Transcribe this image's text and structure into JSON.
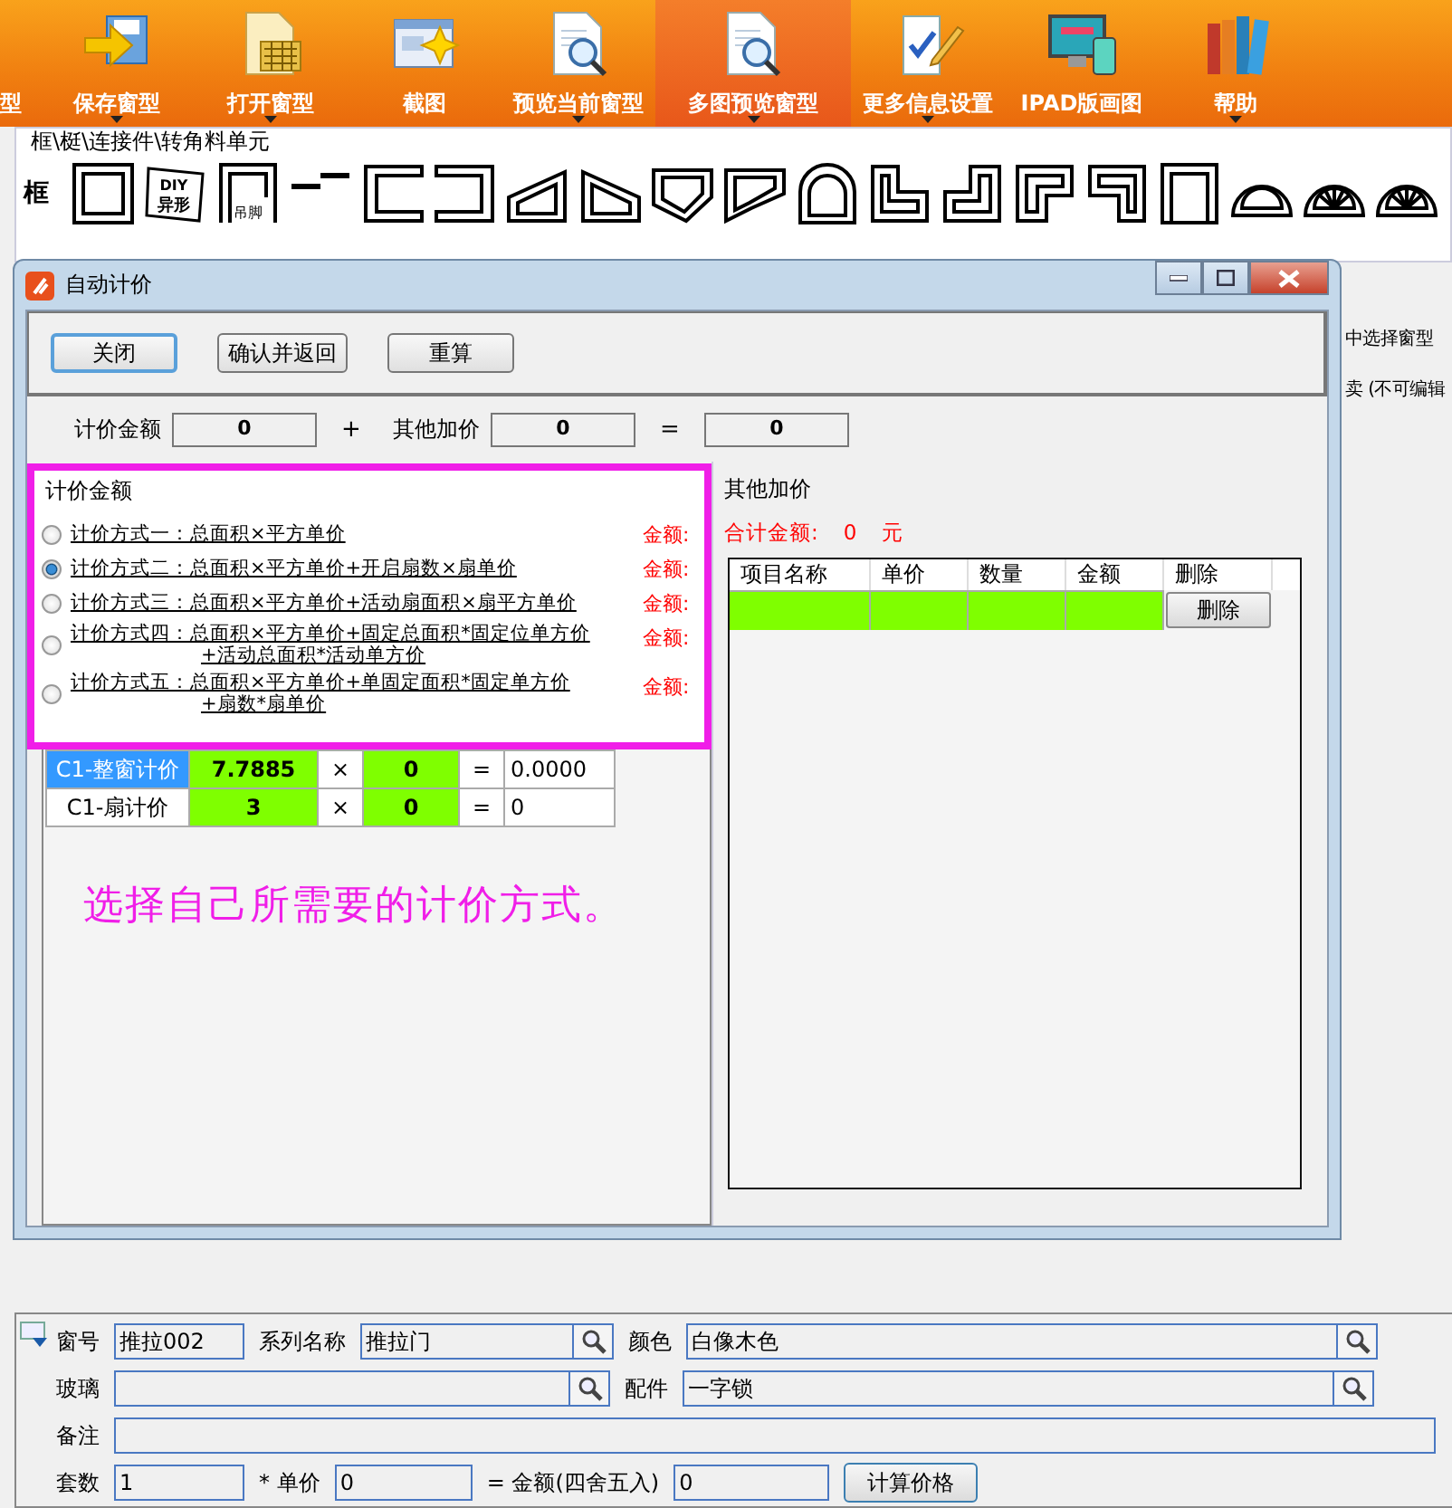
{
  "toolbar": {
    "items": [
      {
        "label": "型",
        "dropdown": false,
        "selected": false
      },
      {
        "label": "保存窗型",
        "dropdown": true,
        "selected": false
      },
      {
        "label": "打开窗型",
        "dropdown": true,
        "selected": false
      },
      {
        "label": "截图",
        "dropdown": false,
        "selected": false
      },
      {
        "label": "预览当前窗型",
        "dropdown": true,
        "selected": false
      },
      {
        "label": "多图预览窗型",
        "dropdown": true,
        "selected": true
      },
      {
        "label": "更多信息设置",
        "dropdown": true,
        "selected": false
      },
      {
        "label": "IPAD版画图",
        "dropdown": false,
        "selected": false
      },
      {
        "label": "帮助",
        "dropdown": true,
        "selected": false
      }
    ]
  },
  "palette": {
    "title": "框\\梃\\连接件\\转角料单元",
    "row_label": "框",
    "shapes": [
      {
        "kind": "square"
      },
      {
        "kind": "tag",
        "lines": [
          "DIY",
          "异形"
        ]
      },
      {
        "kind": "door",
        "label": "吊脚"
      },
      {
        "kind": "step"
      },
      {
        "kind": "c-left"
      },
      {
        "kind": "c-right"
      },
      {
        "kind": "trap-left"
      },
      {
        "kind": "trap-right"
      },
      {
        "kind": "pent-left"
      },
      {
        "kind": "pent-right"
      },
      {
        "kind": "arch"
      },
      {
        "kind": "l-low"
      },
      {
        "kind": "l-high"
      },
      {
        "kind": "z-left"
      },
      {
        "kind": "z-right"
      },
      {
        "kind": "tall"
      },
      {
        "kind": "half"
      },
      {
        "kind": "fan"
      },
      {
        "kind": "fan"
      }
    ]
  },
  "side_texts": [
    "中选择窗型",
    "卖 (不可编辑"
  ],
  "dialog": {
    "title": "自动计价",
    "buttons": [
      {
        "label": "关闭",
        "focused": true
      },
      {
        "label": "确认并返回",
        "focused": false
      },
      {
        "label": "重算",
        "focused": false
      }
    ],
    "sum": [
      {
        "kind": "label",
        "text": "计价金额"
      },
      {
        "kind": "value",
        "text": "0"
      },
      {
        "kind": "operator",
        "text": "+"
      },
      {
        "kind": "label",
        "text": "其他加价"
      },
      {
        "kind": "value",
        "text": "0"
      },
      {
        "kind": "operator",
        "text": "="
      },
      {
        "kind": "value",
        "text": "0"
      }
    ],
    "methods": {
      "legend": "计价金额",
      "options": [
        {
          "lines": [
            "计价方式一：总面积×平方单价"
          ],
          "selected": false,
          "amount_label": "金额:"
        },
        {
          "lines": [
            "计价方式二：总面积×平方单价+开启扇数×扇单价"
          ],
          "selected": true,
          "amount_label": "金额:"
        },
        {
          "lines": [
            "计价方式三：总面积×平方单价+活动扇面积×扇平方单价"
          ],
          "selected": false,
          "amount_label": "金额:"
        },
        {
          "lines": [
            "计价方式四：总面积×平方单价+固定总面积*固定位单方价",
            "+活动总面积*活动单方价"
          ],
          "selected": false,
          "amount_label": "金额:"
        },
        {
          "lines": [
            "计价方式五：总面积×平方单价+单固定面积*固定单方价",
            "+扇数*扇单价"
          ],
          "selected": false,
          "amount_label": "金额:"
        }
      ]
    },
    "price_rows": [
      {
        "name": "C1-整窗计价",
        "selected": true,
        "quantity": "7.7885",
        "times": "×",
        "price": "0",
        "equals": "=",
        "result": "0.0000"
      },
      {
        "name": "C1-扇计价",
        "selected": false,
        "quantity": "3",
        "times": "×",
        "price": "0",
        "equals": "=",
        "result": "0"
      }
    ],
    "annotation": "选择自己所需要的计价方式。",
    "other": {
      "legend": "其他加价",
      "total_label": "合计金额:",
      "total_value": "0",
      "total_unit": "元",
      "columns": [
        "项目名称",
        "单价",
        "数量",
        "金额",
        "删除"
      ],
      "rows": [
        {
          "button": "删除"
        }
      ]
    }
  },
  "form": {
    "fields": [
      {
        "label": "窗号",
        "value": "推拉002",
        "search": false
      },
      {
        "label": "系列名称",
        "value": "推拉门",
        "search": true
      },
      {
        "label": "颜色",
        "value": "白像木色",
        "search": true
      },
      {
        "label": "玻璃",
        "search": true
      },
      {
        "label": "配件",
        "value": "一字锁",
        "search": true
      },
      {
        "label": "备注",
        "search": false
      },
      {
        "label": "套数",
        "value": "1",
        "search": false
      },
      {
        "label": "* 单价",
        "value": "0",
        "search": false
      },
      {
        "label": "= 金额(四舍五入)",
        "value": "0",
        "search": false
      }
    ],
    "button": "计算价格"
  }
}
